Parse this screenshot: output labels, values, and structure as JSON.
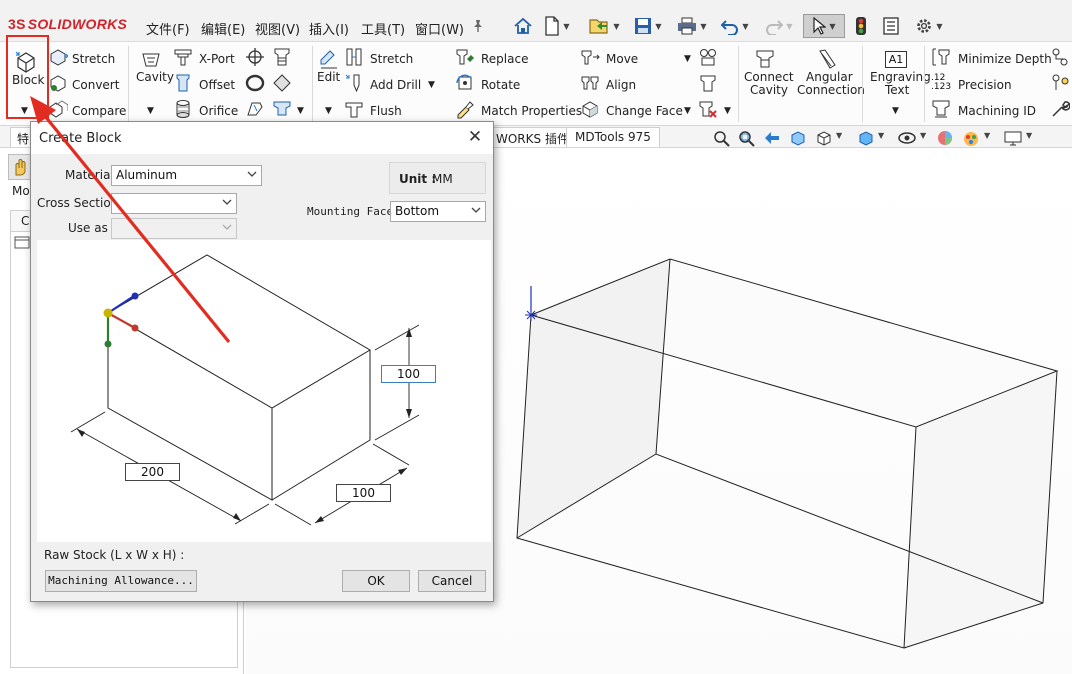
{
  "app": {
    "logo_ds": "3S",
    "logo_text": "SOLIDWORKS"
  },
  "menu": [
    "文件(F)",
    "编辑(E)",
    "视图(V)",
    "插入(I)",
    "工具(T)",
    "窗口(W)"
  ],
  "quick_access_icons": [
    "home-icon",
    "new-file-icon",
    "open-file-icon",
    "save-icon",
    "print-icon",
    "undo-icon",
    "redo-icon",
    "select-pointer-icon",
    "traffic-light-icon",
    "options-list-icon",
    "gear-icon"
  ],
  "ribbon": {
    "block": "Block",
    "stretch": "Stretch",
    "convert": "Convert",
    "compare": "Compare",
    "cavity": "Cavity",
    "xport": "X-Port",
    "offset": "Offset",
    "orifice": "Orifice",
    "edit": "Edit",
    "stretch2": "Stretch",
    "add_drill": "Add Drill",
    "flush": "Flush",
    "replace": "Replace",
    "rotate": "Rotate",
    "match_properties": "Match Properties",
    "move": "Move",
    "align": "Align",
    "change_face": "Change Face",
    "connect_cavity_1": "Connect",
    "connect_cavity_2": "Cavity",
    "angular_connection_1": "Angular",
    "angular_connection_2": "Connection",
    "engraving_text_1": "Engraving",
    "engraving_text_2": "Text",
    "engraving_icon": "A1",
    "minimize_depth": "Minimize Depth",
    "precision": "Precision",
    "precision_icon_1": ".12",
    "precision_icon_2": ".123",
    "machining_id": "Machining ID"
  },
  "tabs": {
    "left_partial": "特",
    "works_plugin": "WORKS 插件",
    "mdtools": "MDTools 975"
  },
  "left_panel": {
    "mod_partial": "Moc",
    "ca_partial": "Ca"
  },
  "dialog": {
    "title": "Create Block",
    "material_label": "Material",
    "material_value": "Aluminum",
    "cross_section_label": "Cross Section",
    "cross_section_value": "",
    "use_as_label": "Use as",
    "use_as_value": "",
    "unit_label": "Unit :",
    "unit_value": "MM",
    "mounting_face_label": "Mounting Face",
    "mounting_face_value": "Bottom",
    "dim_height": "100",
    "dim_length": "200",
    "dim_width": "100",
    "raw_stock_label": "Raw Stock (L x W x H) :",
    "machining_allowance": "Machining Allowance...",
    "ok": "OK",
    "cancel": "Cancel"
  },
  "colors": {
    "annotation_red": "#e32c21",
    "brand_red": "#d2232a",
    "axis_blue": "#1f2fb8",
    "axis_red": "#c0392b",
    "axis_green": "#2e7d32",
    "origin_yellow": "#c8b400"
  }
}
